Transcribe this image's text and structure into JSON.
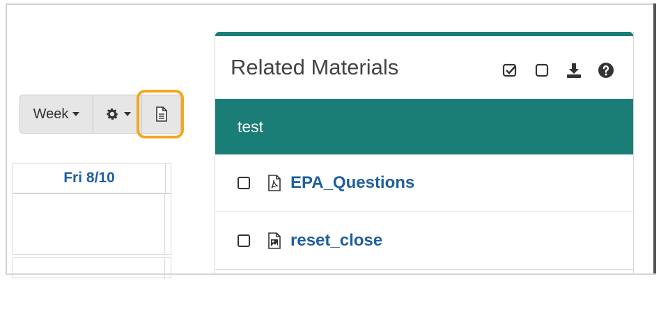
{
  "toolbar": {
    "week_label": "Week"
  },
  "calendar": {
    "day_header": "Fri 8/10"
  },
  "panel": {
    "title": "Related Materials",
    "section": "test",
    "items": [
      {
        "name": "EPA_Questions",
        "icon": "pdf-file-icon"
      },
      {
        "name": "reset_close",
        "icon": "image-file-icon"
      }
    ]
  },
  "colors": {
    "accent_teal": "#1a7d76",
    "link_blue": "#1f5fa0",
    "highlight_orange": "#f5a623"
  }
}
